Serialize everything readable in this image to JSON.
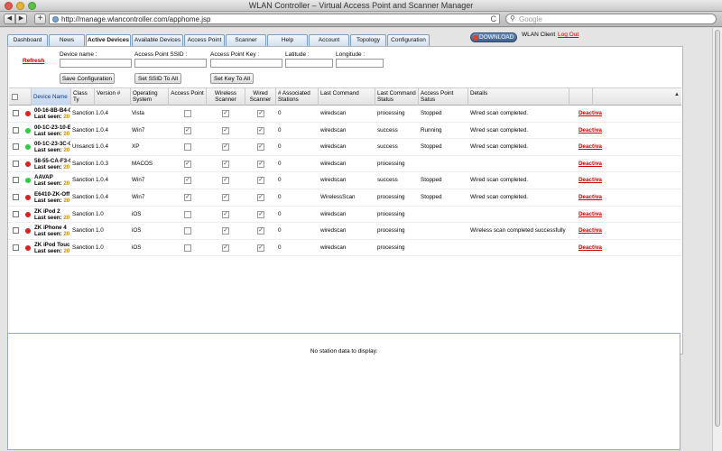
{
  "window": {
    "title": "WLAN Controller – Virtual Access Point and Scanner Manager"
  },
  "toolbar": {
    "back_icon": "back-arrow-icon",
    "forward_icon": "forward-arrow-icon",
    "add_label": "+",
    "url": "http://manage.wlancontroller.com/apphome.jsp",
    "reload_glyph": "C",
    "search_placeholder": "Google"
  },
  "tabs": [
    {
      "label": "Dashboard",
      "active": false
    },
    {
      "label": "News",
      "active": false
    },
    {
      "label": "Active Devices",
      "active": true
    },
    {
      "label": "Available Devices",
      "active": false
    },
    {
      "label": "Access Point",
      "active": false
    },
    {
      "label": "Scanner",
      "active": false
    },
    {
      "label": "Help",
      "active": false
    },
    {
      "label": "Account",
      "active": false
    },
    {
      "label": "Topology",
      "active": false
    },
    {
      "label": "Configuration",
      "active": false
    }
  ],
  "header": {
    "download_label": "DOWNLOAD",
    "client_label": "WLAN Client",
    "logout_label": "Log Out"
  },
  "form": {
    "refresh_label": "Refresh",
    "device_name_label": "Device name :",
    "ssid_label": "Access Point SSID :",
    "key_label": "Access Point Key :",
    "latitude_label": "Latitude :",
    "longitude_label": "Longitude :",
    "save_config_label": "Save Configuration",
    "set_ssid_label": "Set SSID To All",
    "set_key_label": "Set Key To All"
  },
  "grid": {
    "columns": [
      "Device Name",
      "Class Ty",
      "Version #",
      "Operating System",
      "Access Point",
      "Wireless Scanner",
      "Wired Scanner",
      "# Associated Stations",
      "Last Command",
      "Last Command Status",
      "Access Point Satus",
      "Details"
    ],
    "last_seen_label": "Last seen:",
    "last_seen_year": "20",
    "deactivate_label": "Deactiva",
    "rows": [
      {
        "name": "00-16-8B-B4-0",
        "online": false,
        "class": "Sanction",
        "version": "1.0.4",
        "os": "Vista",
        "ap": false,
        "ws": true,
        "wired": true,
        "stations": "0",
        "cmd": "wiredscan",
        "cmd_status": "processing",
        "ap_status": "Stopped",
        "details": "Wired scan completed."
      },
      {
        "name": "00-1C-23-10-E",
        "online": true,
        "class": "Sanction",
        "version": "1.0.4",
        "os": "Win7",
        "ap": true,
        "ws": true,
        "wired": true,
        "stations": "0",
        "cmd": "wiredscan",
        "cmd_status": "success",
        "ap_status": "Running",
        "details": "Wired scan completed."
      },
      {
        "name": "00-1C-23-3C-0",
        "online": true,
        "class": "Unsancti",
        "version": "1.0.4",
        "os": "XP",
        "ap": false,
        "ws": true,
        "wired": true,
        "stations": "0",
        "cmd": "wiredscan",
        "cmd_status": "success",
        "ap_status": "Stopped",
        "details": "Wired scan completed."
      },
      {
        "name": "58-55-CA-F3-C",
        "online": false,
        "class": "Sanction",
        "version": "1.0.3",
        "os": "MACOS",
        "ap": true,
        "ws": true,
        "wired": true,
        "stations": "0",
        "cmd": "wiredscan",
        "cmd_status": "processing",
        "ap_status": "",
        "details": ""
      },
      {
        "name": "AAVAP",
        "online": true,
        "class": "Sanction",
        "version": "1.0.4",
        "os": "Win7",
        "ap": true,
        "ws": true,
        "wired": true,
        "stations": "0",
        "cmd": "wiredscan",
        "cmd_status": "success",
        "ap_status": "Stopped",
        "details": "Wired scan completed."
      },
      {
        "name": "E6410-ZK-Off",
        "online": false,
        "class": "Sanction",
        "version": "1.0.4",
        "os": "Win7",
        "ap": true,
        "ws": true,
        "wired": true,
        "stations": "0",
        "cmd": "WirelessScan",
        "cmd_status": "processing",
        "ap_status": "Stopped",
        "details": "Wired scan completed."
      },
      {
        "name": "ZK iPod 2",
        "online": false,
        "class": "Sanction",
        "version": "1.0",
        "os": "iOS",
        "ap": false,
        "ws": true,
        "wired": true,
        "stations": "0",
        "cmd": "wiredscan",
        "cmd_status": "processing",
        "ap_status": "",
        "details": ""
      },
      {
        "name": "ZK iPhone 4",
        "online": false,
        "class": "Sanction",
        "version": "1.0",
        "os": "iOS",
        "ap": false,
        "ws": true,
        "wired": true,
        "stations": "0",
        "cmd": "wiredscan",
        "cmd_status": "processing",
        "ap_status": "",
        "details": "Wireless scan completed successfully"
      },
      {
        "name": "ZK iPod Touc",
        "online": false,
        "class": "Sanction",
        "version": "1.0",
        "os": "iOS",
        "ap": false,
        "ws": true,
        "wired": true,
        "stations": "0",
        "cmd": "wiredscan",
        "cmd_status": "processing",
        "ap_status": "",
        "details": ""
      }
    ]
  },
  "station": {
    "empty_message": "No station data to display."
  },
  "colors": {
    "online": "#2ecc40",
    "offline": "#e02020",
    "link": "#cc0000"
  }
}
